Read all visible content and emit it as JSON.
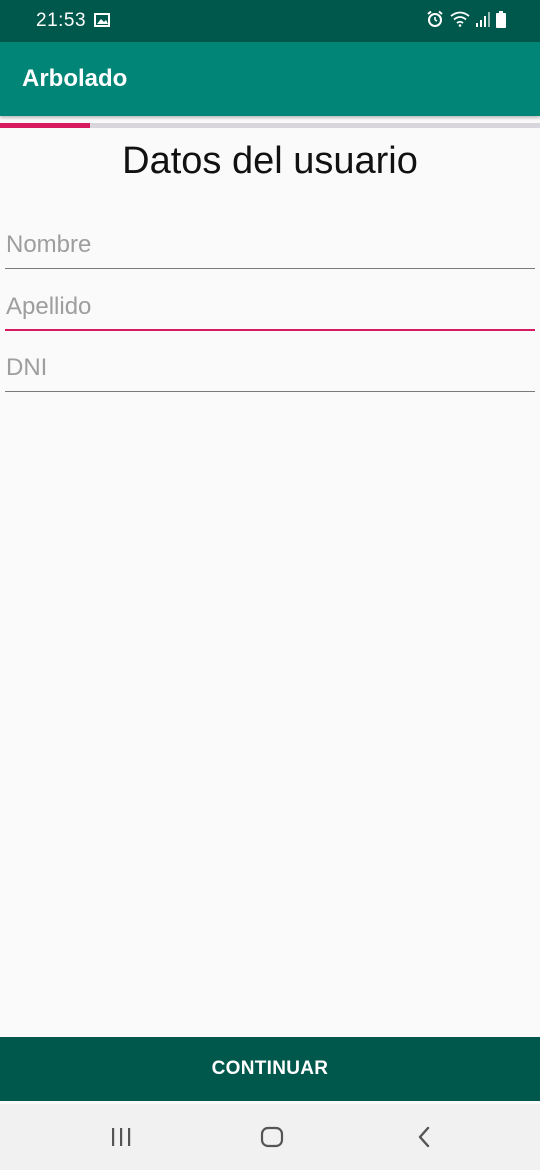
{
  "status_bar": {
    "time": "21:53",
    "icons": [
      "gallery-icon",
      "alarm-icon",
      "wifi-icon",
      "signal-icon",
      "battery-icon"
    ]
  },
  "app_bar": {
    "title": "Arbolado"
  },
  "progress": {
    "fraction": 0.167,
    "color": "#d81b60",
    "track_color": "#d9d5dc"
  },
  "form": {
    "title": "Datos del usuario",
    "fields": [
      {
        "placeholder": "Nombre",
        "value": "",
        "focused": false
      },
      {
        "placeholder": "Apellido",
        "value": "",
        "focused": true
      },
      {
        "placeholder": "DNI",
        "value": "",
        "focused": false
      }
    ]
  },
  "continue_button": {
    "label": "CONTINUAR"
  },
  "nav_bar": {
    "icons": [
      "recent-apps-icon",
      "home-icon",
      "back-icon"
    ]
  },
  "colors": {
    "primary": "#008577",
    "primary_dark": "#00574b",
    "accent": "#d81b60",
    "background": "#fafafa"
  }
}
